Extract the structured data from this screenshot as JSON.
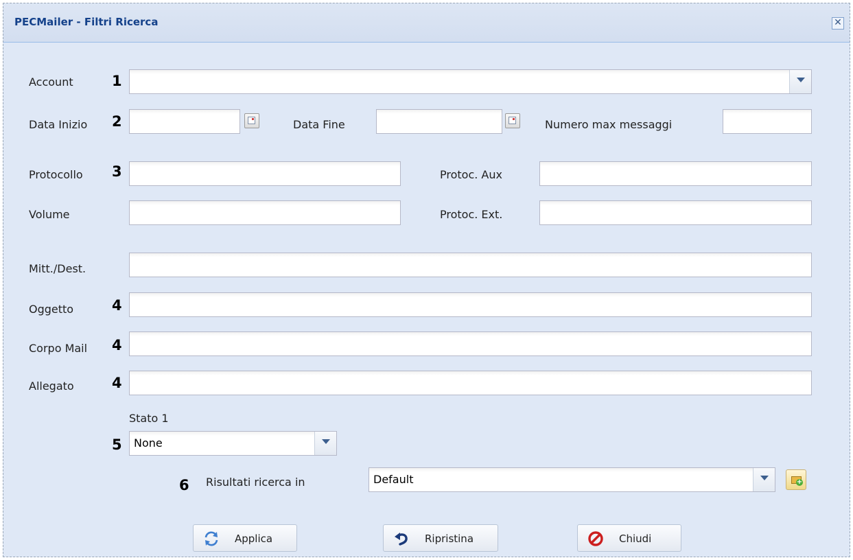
{
  "window": {
    "title": "PECMailer - Filtri Ricerca",
    "close_glyph": "✕"
  },
  "labels": {
    "account": "Account",
    "data_inizio": "Data Inizio",
    "data_fine": "Data Fine",
    "numero_max": "Numero max messaggi",
    "protocollo": "Protocollo",
    "protoc_aux": "Protoc. Aux",
    "volume": "Volume",
    "protoc_ext": "Protoc. Ext.",
    "mitt_dest": "Mitt./Dest.",
    "oggetto": "Oggetto",
    "corpo_mail": "Corpo Mail",
    "allegato": "Allegato",
    "stato": "Stato 1",
    "risultati": "Risultati ricerca in"
  },
  "markers": {
    "m1": "1",
    "m2": "2",
    "m3": "3",
    "m4a": "4",
    "m4b": "4",
    "m4c": "4",
    "m5": "5",
    "m6": "6"
  },
  "fields": {
    "account": "",
    "data_inizio": "",
    "data_fine": "",
    "numero_max": "",
    "protocollo": "",
    "protoc_aux": "",
    "volume": "",
    "protoc_ext": "",
    "mitt_dest": "",
    "oggetto": "",
    "corpo_mail": "",
    "allegato": "",
    "stato": "None",
    "risultati": "Default"
  },
  "buttons": {
    "applica": "Applica",
    "ripristina": "Ripristina",
    "chiudi": "Chiudi"
  },
  "icons": {
    "close": "close-icon",
    "dropdown": "chevron-down-icon",
    "calendar": "calendar-icon",
    "add_folder": "add-folder-icon",
    "refresh": "refresh-icon",
    "undo": "undo-icon",
    "stop": "stop-icon"
  },
  "colors": {
    "title": "#15428b",
    "panel_bg": "#dfe8f6",
    "field_border": "#b5b8c8"
  }
}
